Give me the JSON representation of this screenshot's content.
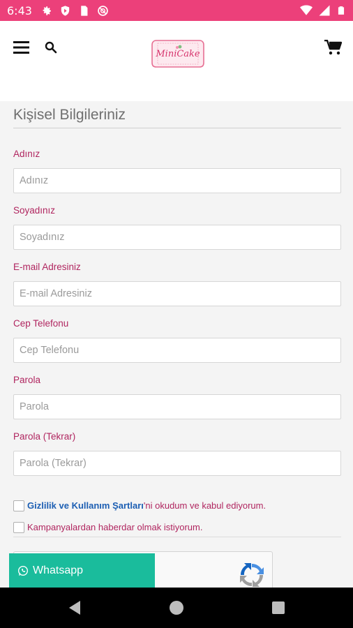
{
  "status_bar": {
    "time": "6:43",
    "left_icons": [
      "gear-icon",
      "shield-icon",
      "sim-icon",
      "no-disturb-icon"
    ],
    "right_icons": [
      "wifi-icon",
      "signal-icon",
      "battery-icon"
    ],
    "color": "#ec407a"
  },
  "header": {
    "logo_alt": "MiniCake",
    "icons": [
      "menu-icon",
      "search-icon",
      "cart-icon"
    ]
  },
  "form": {
    "section_title": "Kişisel Bilgileriniz",
    "fields": [
      {
        "label": "Adınız",
        "placeholder": "Adınız",
        "value": ""
      },
      {
        "label": "Soyadınız",
        "placeholder": "Soyadınız",
        "value": ""
      },
      {
        "label": "E-mail Adresiniz",
        "placeholder": "E-mail Adresiniz",
        "value": ""
      },
      {
        "label": "Cep Telefonu",
        "placeholder": "Cep Telefonu",
        "value": ""
      },
      {
        "label": "Parola",
        "placeholder": "Parola",
        "value": ""
      },
      {
        "label": "Parola (Tekrar)",
        "placeholder": "Parola (Tekrar)",
        "value": ""
      }
    ],
    "terms_link": "Gizlilik ve Kullanım Şartları",
    "terms_suffix": "'ni okudum ve kabul ediyorum.",
    "campaign_text": "Kampanyalardan haberdar olmak istiyorum."
  },
  "whatsapp_button": {
    "label": "Whatsapp",
    "color": "#1abc9c"
  },
  "colors": {
    "label": "#b0255f",
    "link": "#1d5fb3",
    "accent": "#ec407a"
  }
}
